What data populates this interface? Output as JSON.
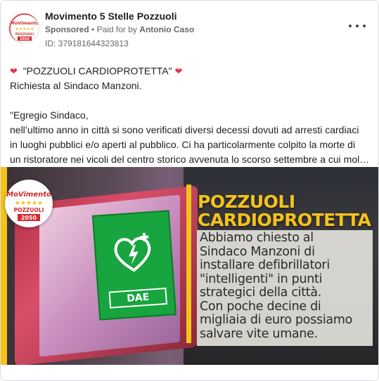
{
  "post": {
    "page_name": "Movimento 5 Stelle Pozzuoli",
    "sponsored_label": "Sponsored",
    "separator": "•",
    "paid_for_prefix": "Paid for by",
    "paid_for_name": "Antonio Caso",
    "ad_id": "ID: 379181644323813",
    "menu_icon": "more-horizontal-icon"
  },
  "logo": {
    "word_top": "MoVimento",
    "word_city": "POZZUOLI",
    "word_year": "2050",
    "colors": {
      "red": "#d8262c",
      "yellow": "#f4c21c",
      "green": "#2a8b3b"
    }
  },
  "text": {
    "line1": "\"POZZUOLI CARDIOPROTETTA\"",
    "line2": "Richiesta al Sindaco Manzoni.",
    "line3": "\"Egregio Sindaco,",
    "line4": "nell’ultimo anno in città si sono verificati diversi decessi dovuti ad arresti cardiaci",
    "line5": "in luoghi pubblici e/o aperti al pubblico. Ci ha particolarmente colpito la morte di",
    "line6": "un ristoratore nei vicoli del centro storico avvenuta lo scorso settembre a cui mol…",
    "heart_icon": "red-heart-icon"
  },
  "creative": {
    "title_line1": "POZZUOLI",
    "title_line2": "CARDIOPROTETTA",
    "message": [
      "Abbiamo chiesto al",
      "Sindaco Manzoni di",
      "installare defibrillatori",
      "\"intelligenti\" in punti",
      "strategici della città.",
      "Con poche decine di",
      "migliaia di euro possiamo",
      "salvare vite umane."
    ],
    "dae_label": "DAE",
    "accent": "#f4c21c",
    "sign_green": "#18a43e"
  }
}
